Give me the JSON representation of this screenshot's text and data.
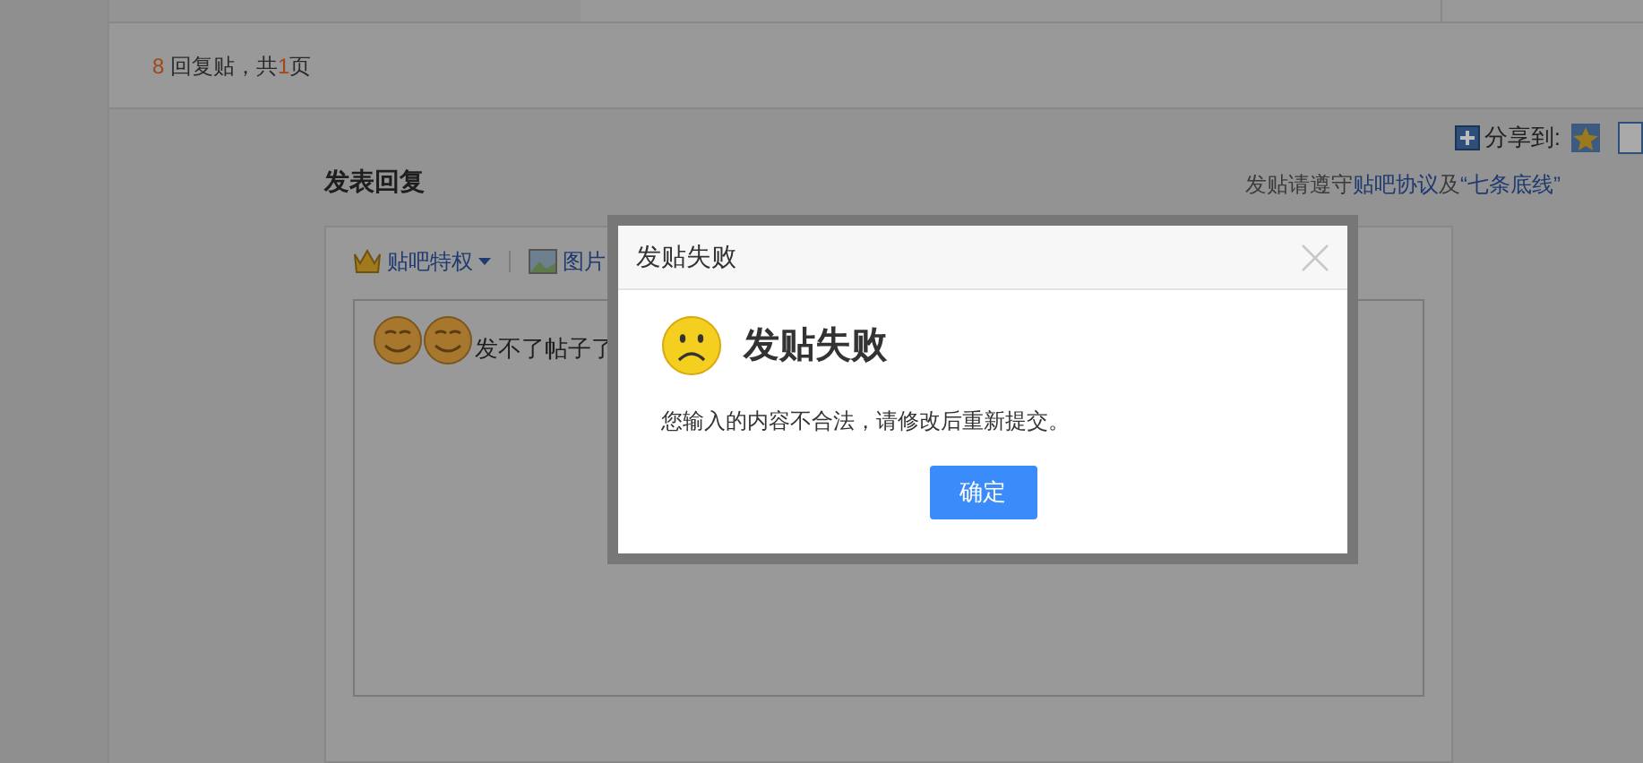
{
  "reply_summary": {
    "count": "8",
    "label": "回复贴，共",
    "pages": "1",
    "suffix": "页"
  },
  "share": {
    "label": "分享到:"
  },
  "reply_form": {
    "title": "发表回复",
    "notice": {
      "text": "发贴请遵守",
      "link1": "贴吧协议",
      "joiner": "及",
      "link2": "“七条底线”"
    },
    "toolbar": [
      {
        "kind": "crown",
        "label": "贴吧特权",
        "caret": true
      },
      {
        "kind": "image",
        "label": "图片",
        "caret": false
      }
    ],
    "editor": {
      "emoticons": [
        {
          "kind": "smile"
        },
        {
          "kind": "smile"
        }
      ],
      "text": "发不了帖子了"
    }
  },
  "dialog": {
    "title": "发贴失败",
    "heading": "发贴失败",
    "message": "您输入的内容不合法，请修改后重新提交。",
    "button": "确定"
  }
}
